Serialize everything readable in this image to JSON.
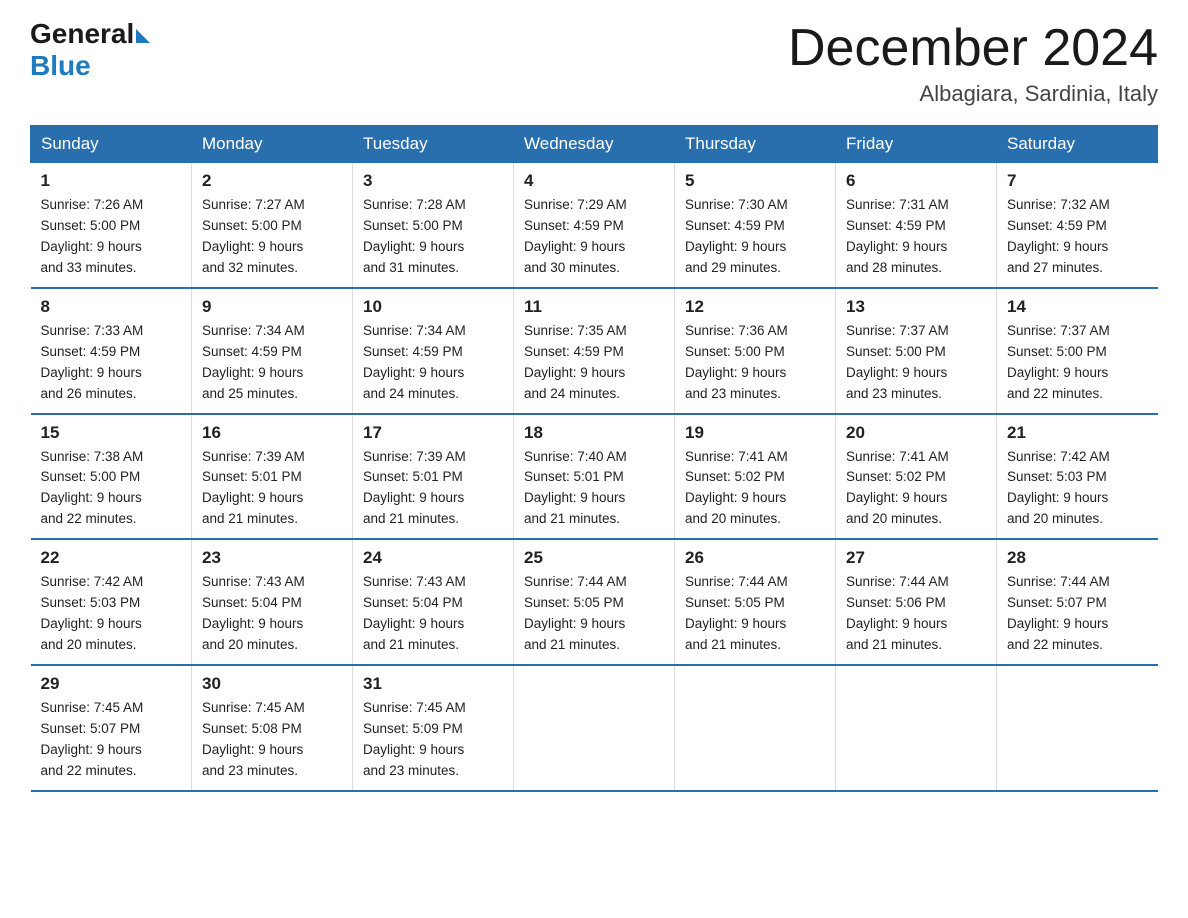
{
  "header": {
    "logo_general": "General",
    "logo_blue": "Blue",
    "month_title": "December 2024",
    "location": "Albagiara, Sardinia, Italy"
  },
  "days_of_week": [
    "Sunday",
    "Monday",
    "Tuesday",
    "Wednesday",
    "Thursday",
    "Friday",
    "Saturday"
  ],
  "weeks": [
    [
      {
        "day": "1",
        "sunrise": "7:26 AM",
        "sunset": "5:00 PM",
        "daylight": "9 hours and 33 minutes."
      },
      {
        "day": "2",
        "sunrise": "7:27 AM",
        "sunset": "5:00 PM",
        "daylight": "9 hours and 32 minutes."
      },
      {
        "day": "3",
        "sunrise": "7:28 AM",
        "sunset": "5:00 PM",
        "daylight": "9 hours and 31 minutes."
      },
      {
        "day": "4",
        "sunrise": "7:29 AM",
        "sunset": "4:59 PM",
        "daylight": "9 hours and 30 minutes."
      },
      {
        "day": "5",
        "sunrise": "7:30 AM",
        "sunset": "4:59 PM",
        "daylight": "9 hours and 29 minutes."
      },
      {
        "day": "6",
        "sunrise": "7:31 AM",
        "sunset": "4:59 PM",
        "daylight": "9 hours and 28 minutes."
      },
      {
        "day": "7",
        "sunrise": "7:32 AM",
        "sunset": "4:59 PM",
        "daylight": "9 hours and 27 minutes."
      }
    ],
    [
      {
        "day": "8",
        "sunrise": "7:33 AM",
        "sunset": "4:59 PM",
        "daylight": "9 hours and 26 minutes."
      },
      {
        "day": "9",
        "sunrise": "7:34 AM",
        "sunset": "4:59 PM",
        "daylight": "9 hours and 25 minutes."
      },
      {
        "day": "10",
        "sunrise": "7:34 AM",
        "sunset": "4:59 PM",
        "daylight": "9 hours and 24 minutes."
      },
      {
        "day": "11",
        "sunrise": "7:35 AM",
        "sunset": "4:59 PM",
        "daylight": "9 hours and 24 minutes."
      },
      {
        "day": "12",
        "sunrise": "7:36 AM",
        "sunset": "5:00 PM",
        "daylight": "9 hours and 23 minutes."
      },
      {
        "day": "13",
        "sunrise": "7:37 AM",
        "sunset": "5:00 PM",
        "daylight": "9 hours and 23 minutes."
      },
      {
        "day": "14",
        "sunrise": "7:37 AM",
        "sunset": "5:00 PM",
        "daylight": "9 hours and 22 minutes."
      }
    ],
    [
      {
        "day": "15",
        "sunrise": "7:38 AM",
        "sunset": "5:00 PM",
        "daylight": "9 hours and 22 minutes."
      },
      {
        "day": "16",
        "sunrise": "7:39 AM",
        "sunset": "5:01 PM",
        "daylight": "9 hours and 21 minutes."
      },
      {
        "day": "17",
        "sunrise": "7:39 AM",
        "sunset": "5:01 PM",
        "daylight": "9 hours and 21 minutes."
      },
      {
        "day": "18",
        "sunrise": "7:40 AM",
        "sunset": "5:01 PM",
        "daylight": "9 hours and 21 minutes."
      },
      {
        "day": "19",
        "sunrise": "7:41 AM",
        "sunset": "5:02 PM",
        "daylight": "9 hours and 20 minutes."
      },
      {
        "day": "20",
        "sunrise": "7:41 AM",
        "sunset": "5:02 PM",
        "daylight": "9 hours and 20 minutes."
      },
      {
        "day": "21",
        "sunrise": "7:42 AM",
        "sunset": "5:03 PM",
        "daylight": "9 hours and 20 minutes."
      }
    ],
    [
      {
        "day": "22",
        "sunrise": "7:42 AM",
        "sunset": "5:03 PM",
        "daylight": "9 hours and 20 minutes."
      },
      {
        "day": "23",
        "sunrise": "7:43 AM",
        "sunset": "5:04 PM",
        "daylight": "9 hours and 20 minutes."
      },
      {
        "day": "24",
        "sunrise": "7:43 AM",
        "sunset": "5:04 PM",
        "daylight": "9 hours and 21 minutes."
      },
      {
        "day": "25",
        "sunrise": "7:44 AM",
        "sunset": "5:05 PM",
        "daylight": "9 hours and 21 minutes."
      },
      {
        "day": "26",
        "sunrise": "7:44 AM",
        "sunset": "5:05 PM",
        "daylight": "9 hours and 21 minutes."
      },
      {
        "day": "27",
        "sunrise": "7:44 AM",
        "sunset": "5:06 PM",
        "daylight": "9 hours and 21 minutes."
      },
      {
        "day": "28",
        "sunrise": "7:44 AM",
        "sunset": "5:07 PM",
        "daylight": "9 hours and 22 minutes."
      }
    ],
    [
      {
        "day": "29",
        "sunrise": "7:45 AM",
        "sunset": "5:07 PM",
        "daylight": "9 hours and 22 minutes."
      },
      {
        "day": "30",
        "sunrise": "7:45 AM",
        "sunset": "5:08 PM",
        "daylight": "9 hours and 23 minutes."
      },
      {
        "day": "31",
        "sunrise": "7:45 AM",
        "sunset": "5:09 PM",
        "daylight": "9 hours and 23 minutes."
      },
      null,
      null,
      null,
      null
    ]
  ],
  "labels": {
    "sunrise_label": "Sunrise:",
    "sunset_label": "Sunset:",
    "daylight_label": "Daylight:"
  }
}
